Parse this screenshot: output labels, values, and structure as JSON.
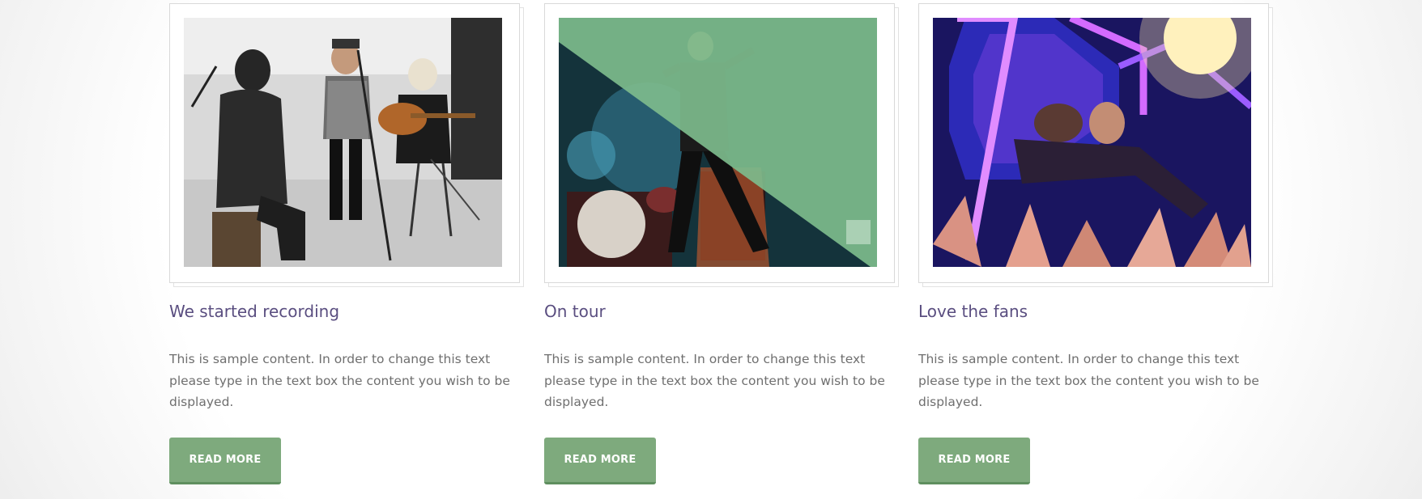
{
  "cards": [
    {
      "title": "We started recording",
      "text": "This is sample content. In order to change this text please type in the text box the content you wish to be displayed.",
      "button": "READ MORE",
      "image_alt": "Band playing an acoustic set in a studio"
    },
    {
      "title": "On tour",
      "text": "This is sample content. In order to change this text please type in the text box the content you wish to be displayed.",
      "button": "READ MORE",
      "image_alt": "Singer performing on stage with a green overlay"
    },
    {
      "title": "Love the fans",
      "text": "This is sample content. In order to change this text please type in the text box the content you wish to be displayed.",
      "button": "READ MORE",
      "image_alt": "Singer reaching out to the crowd under purple lights"
    }
  ],
  "colors": {
    "title": "#5a4e80",
    "body_text": "#6f6f6f",
    "button_bg": "#7eaa7d",
    "button_shadow": "#5f8f5f",
    "photo_overlay": "#7dbb8c"
  }
}
